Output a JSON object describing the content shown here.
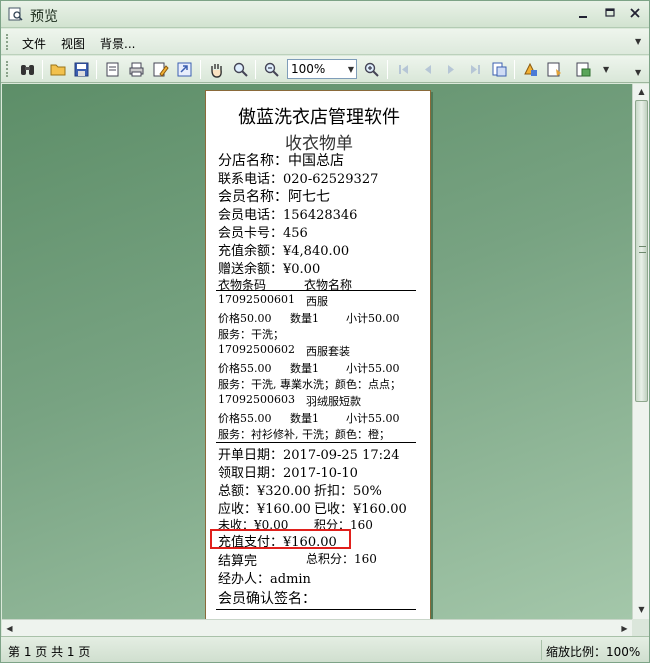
{
  "window": {
    "title": "预览"
  },
  "menu": {
    "items": [
      "文件",
      "视图",
      "背景..."
    ]
  },
  "toolbar": {
    "zoom_value": "100%",
    "icons": [
      "binoculars-icon",
      "open-icon",
      "save-icon",
      "print-setup-icon",
      "print-icon",
      "edit-icon",
      "export-icon",
      "hand-icon",
      "magnifier-icon",
      "zoom-out-icon",
      "zoom-in-icon",
      "first-page-icon",
      "prev-page-icon",
      "next-page-icon",
      "last-page-icon",
      "page-setup-icon",
      "background-icon",
      "watermark-icon",
      "scale-icon",
      "export-menu-icon"
    ]
  },
  "receipt": {
    "store_name": "傲蓝洗衣店管理软件",
    "doc_title": "收衣物单",
    "branch": "分店名称：中国总店",
    "phone": "联系电话：020-62529327",
    "member_name": "会员名称：阿七七",
    "member_phone": "会员电话：156428346",
    "card_no": "会员卡号：456",
    "recharge_balance": "充值余额：¥4,840.00",
    "gift_balance": "赠送余额：¥0.00",
    "col_code": "衣物条码",
    "col_name": "衣物名称",
    "items": [
      {
        "code": "17092500601",
        "name": "西服",
        "price": "价格50.00",
        "qty": "数量1",
        "subtotal": "小计50.00",
        "service": "服务：干洗；"
      },
      {
        "code": "17092500602",
        "name": "西服套装",
        "price": "价格55.00",
        "qty": "数量1",
        "subtotal": "小计55.00",
        "service": "服务：干洗, 專業水洗；颜色：点点；"
      },
      {
        "code": "17092500603",
        "name": "羽绒服短款",
        "price": "价格55.00",
        "qty": "数量1",
        "subtotal": "小计55.00",
        "service": "服务：衬衫修补, 干洗；颜色：橙；"
      }
    ],
    "open_date": "开单日期：2017-09-25 17:24",
    "pickup_date": "领取日期：2017-10-10",
    "total": "总额：¥320.00",
    "discount": "折扣：50%",
    "receivable": "应收：¥160.00",
    "received": "已收：¥160.00",
    "unpaid": "未收：¥0.00",
    "points": "积分：160",
    "recharge_pay": "充值支付：¥160.00",
    "settled": "结算完",
    "total_points": "总积分：160",
    "operator": "经办人：admin",
    "signature": "会员确认签名："
  },
  "status": {
    "page_info": "第 1 页 共 1 页",
    "zoom_info": "缩放比例：100%"
  },
  "colors": {
    "highlight_border": "#e0201c",
    "preview_bg": "#78a382"
  }
}
